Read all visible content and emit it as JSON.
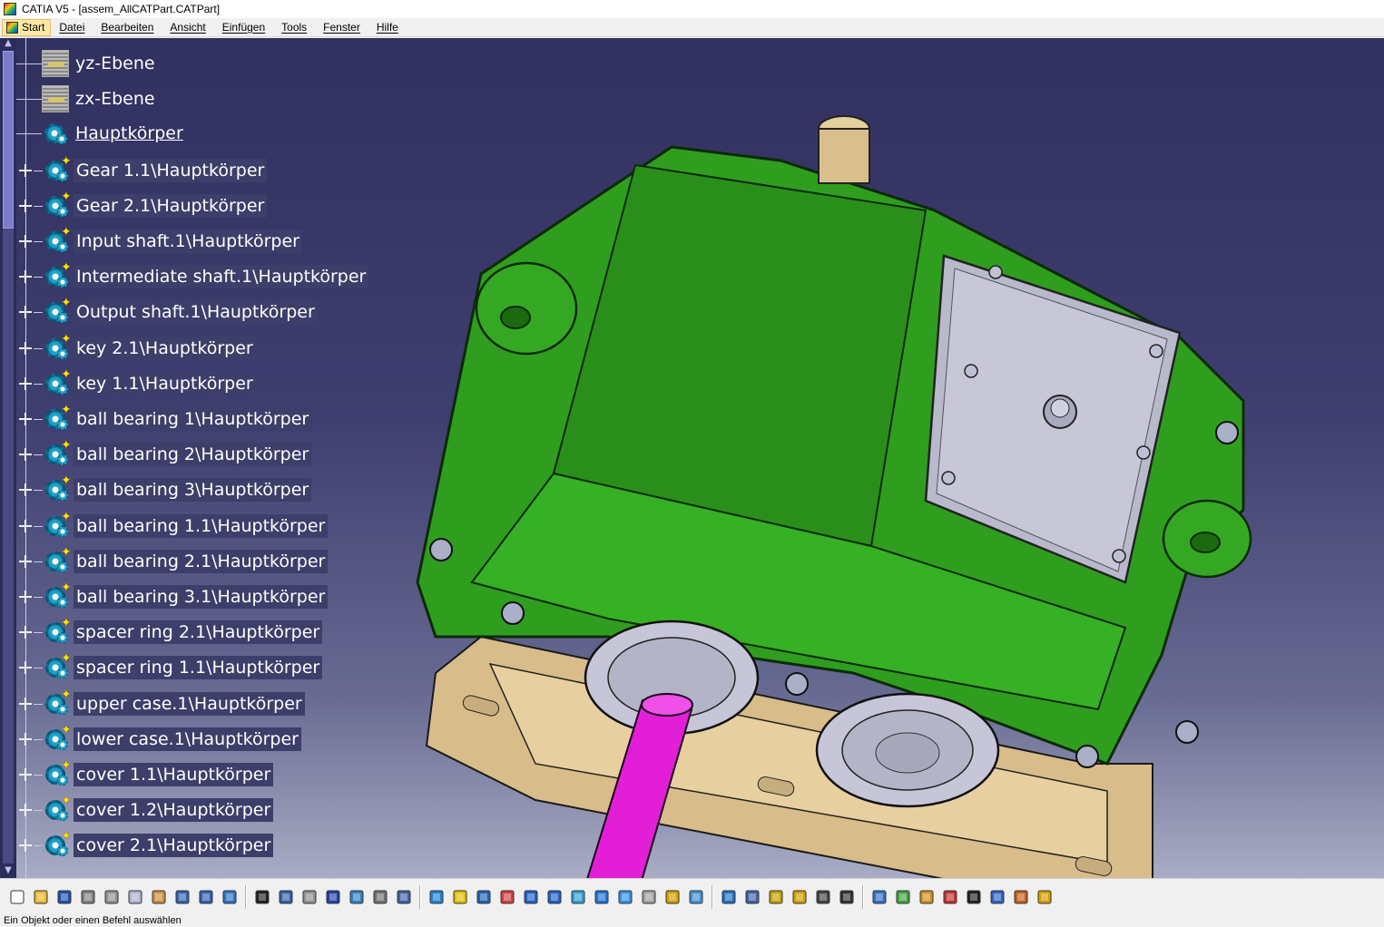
{
  "window": {
    "title": "CATIA V5 - [assem_AllCATPart.CATPart]"
  },
  "menubar": {
    "items": [
      "Start",
      "Datei",
      "Bearbeiten",
      "Ansicht",
      "Einfügen",
      "Tools",
      "Fenster",
      "Hilfe"
    ]
  },
  "tree": {
    "items": [
      {
        "label": "yz-Ebene",
        "icon": "plane-icon",
        "expandable": false
      },
      {
        "label": "zx-Ebene",
        "icon": "plane-icon",
        "expandable": false
      },
      {
        "label": "Hauptkörper",
        "icon": "part-body-icon",
        "expandable": false,
        "underlined": true
      },
      {
        "label": "Gear 1.1\\Hauptkörper",
        "icon": "part-body-icon",
        "expandable": true
      },
      {
        "label": "Gear 2.1\\Hauptkörper",
        "icon": "part-body-icon",
        "expandable": true
      },
      {
        "label": "Input shaft.1\\Hauptkörper",
        "icon": "part-body-icon",
        "expandable": true
      },
      {
        "label": "Intermediate shaft.1\\Hauptkörper",
        "icon": "part-body-icon",
        "expandable": true
      },
      {
        "label": "Output shaft.1\\Hauptkörper",
        "icon": "part-body-icon",
        "expandable": true
      },
      {
        "label": "key 2.1\\Hauptkörper",
        "icon": "part-body-icon",
        "expandable": true
      },
      {
        "label": "key 1.1\\Hauptkörper",
        "icon": "part-body-icon",
        "expandable": true
      },
      {
        "label": "ball  bearing 1\\Hauptkörper",
        "icon": "part-body-icon",
        "expandable": true
      },
      {
        "label": "ball  bearing 2\\Hauptkörper",
        "icon": "part-body-icon",
        "expandable": true
      },
      {
        "label": "ball  bearing 3\\Hauptkörper",
        "icon": "part-body-icon",
        "expandable": true
      },
      {
        "label": "ball  bearing 1.1\\Hauptkörper",
        "icon": "part-body-icon",
        "expandable": true
      },
      {
        "label": "ball  bearing 2.1\\Hauptkörper",
        "icon": "part-body-icon",
        "expandable": true
      },
      {
        "label": "ball  bearing 3.1\\Hauptkörper",
        "icon": "part-body-icon",
        "expandable": true
      },
      {
        "label": "spacer ring 2.1\\Hauptkörper",
        "icon": "part-body-icon",
        "expandable": true
      },
      {
        "label": "spacer ring 1.1\\Hauptkörper",
        "icon": "part-body-icon",
        "expandable": true
      },
      {
        "label": "upper case.1\\Hauptkörper",
        "icon": "part-body-icon",
        "expandable": true
      },
      {
        "label": "lower case.1\\Hauptkörper",
        "icon": "part-body-icon",
        "expandable": true
      },
      {
        "label": "cover 1.1\\Hauptkörper",
        "icon": "part-body-icon",
        "expandable": true
      },
      {
        "label": "cover 1.2\\Hauptkörper",
        "icon": "part-body-icon",
        "expandable": true
      },
      {
        "label": "cover 2.1\\Hauptkörper",
        "icon": "part-body-icon",
        "expandable": true
      }
    ]
  },
  "model": {
    "colors": {
      "upper_case": "#2f9e1f",
      "lower_case": "#e0c596",
      "output_shaft": "#e21fd6",
      "input_shaft": "#d8bf8c",
      "cover": "#b9b9cc",
      "background_top": "#31305f",
      "background_bottom": "#a9acc4"
    }
  },
  "toolbar": {
    "buttons": [
      "new-icon",
      "open-icon",
      "save-icon",
      "print-icon",
      "cut-icon",
      "copy-icon",
      "paste-icon",
      "undo-icon",
      "redo-icon",
      "whats-this-icon",
      "formula-icon",
      "comment-icon",
      "macro-icon",
      "table-icon",
      "tree-icon",
      "lock-icon",
      "catalog-icon",
      "fly-icon",
      "fit-all-icon",
      "pan-icon",
      "rotate-icon",
      "zoom-in-icon",
      "zoom-out-icon",
      "normal-view-icon",
      "multi-view-icon",
      "iso-view-icon",
      "shading-icon",
      "hide-show-icon",
      "swap-space-icon",
      "update-icon",
      "measure-icon",
      "inertia-icon",
      "bottle-icon",
      "camera-icon",
      "axis-icon",
      "sketch-icon",
      "wireframe-icon",
      "surface-icon",
      "material-icon",
      "render-icon",
      "grid-icon",
      "knowledge-icon",
      "snap-icon"
    ]
  },
  "statusbar": {
    "text": "Ein Objekt oder einen Befehl auswählen"
  }
}
